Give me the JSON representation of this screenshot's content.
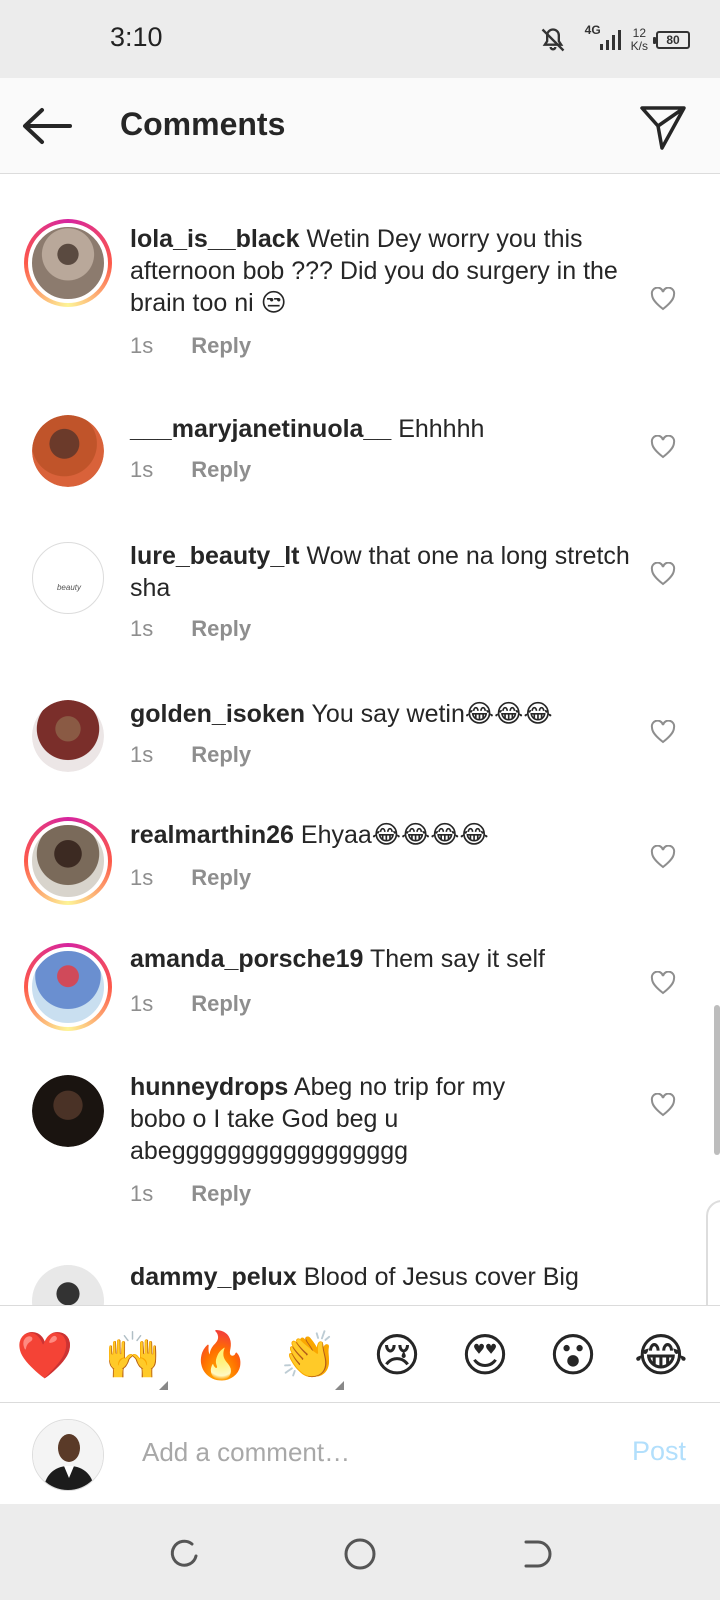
{
  "status_bar": {
    "time": "3:10",
    "network": "4G",
    "speed": "12",
    "speed_unit": "K/s",
    "battery": "80"
  },
  "header": {
    "title": "Comments"
  },
  "comments": [
    {
      "username": "lola_is__black",
      "text": "Wetin Dey worry you this afternoon bob ??? Did you do surgery in the brain too ni 😒",
      "time": "1s",
      "reply": "Reply"
    },
    {
      "username": "___maryjanetinuola__",
      "text": "Ehhhhh",
      "time": "1s",
      "reply": "Reply"
    },
    {
      "username": "lure_beauty_lt",
      "text": "Wow that one na long stretch sha",
      "time": "1s",
      "reply": "Reply",
      "avatar_text": "beauty"
    },
    {
      "username": "golden_isoken",
      "text": "You say wetin😂😂😂",
      "time": "1s",
      "reply": "Reply"
    },
    {
      "username": "realmarthin26",
      "text": "Ehyaa😂😂😂😂",
      "time": "1s",
      "reply": "Reply"
    },
    {
      "username": "amanda_porsche19",
      "text": "Them say it self",
      "time": "1s",
      "reply": "Reply"
    },
    {
      "username": "hunneydrops",
      "text": "Abeg no trip for my bobo o I take God beg u abeggggggggggggggggg",
      "time": "1s",
      "reply": "Reply"
    },
    {
      "username": "dammy_pelux",
      "text": "Blood of Jesus cover Big"
    }
  ],
  "emoji_bar": [
    "❤️",
    "🙌",
    "🔥",
    "👏",
    "😢",
    "😍",
    "😮",
    "😂"
  ],
  "composer": {
    "placeholder": "Add a comment…",
    "post_label": "Post"
  },
  "colors": {
    "post_disabled": "#b2dffc",
    "meta_gray": "#8e8e8e",
    "story_ring": "#d6249f"
  }
}
